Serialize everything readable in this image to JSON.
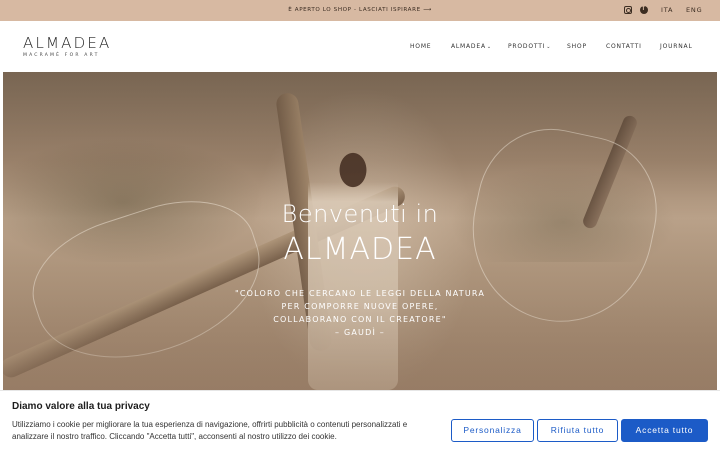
{
  "topbar": {
    "announcement": "È APERTO LO SHOP - LASCIATI ISPIRARE ⟶",
    "languages": [
      "ITA",
      "ENG"
    ],
    "social_icons": [
      "instagram-icon",
      "facebook-icon"
    ],
    "background_color": "#d7b9a2"
  },
  "header": {
    "logo_name": "ALMADEA",
    "logo_tagline": "MACRAMÈ FOR ART",
    "nav": [
      {
        "label": "HOME",
        "caret": ""
      },
      {
        "label": "ALMADEA",
        "caret": "⌄"
      },
      {
        "label": "PRODOTTI",
        "caret": "⌄"
      },
      {
        "label": "SHOP",
        "caret": ""
      },
      {
        "label": "CONTATTI",
        "caret": ""
      },
      {
        "label": "JOURNAL",
        "caret": ""
      }
    ]
  },
  "hero": {
    "welcome": "Benvenuti in",
    "brand": "ALMADEA",
    "quote_lines": [
      "\"COLORO CHE CERCANO LE LEGGI DELLA NATURA",
      "PER COMPORRE NUOVE OPERE,",
      "COLLABORANO CON IL CREATORE\"",
      "– GAUDÌ –"
    ]
  },
  "cookie": {
    "title": "Diamo valore alla tua privacy",
    "text": "Utilizziamo i cookie per migliorare la tua esperienza di navigazione, offrirti pubblicità o contenuti personalizzati e analizzare il nostro traffico. Cliccando \"Accetta tutti\", acconsenti al nostro utilizzo dei cookie.",
    "customize_label": "Personalizza",
    "reject_label": "Rifiuta tutto",
    "accept_label": "Accetta tutto",
    "accent_color": "#1c5bc7"
  }
}
